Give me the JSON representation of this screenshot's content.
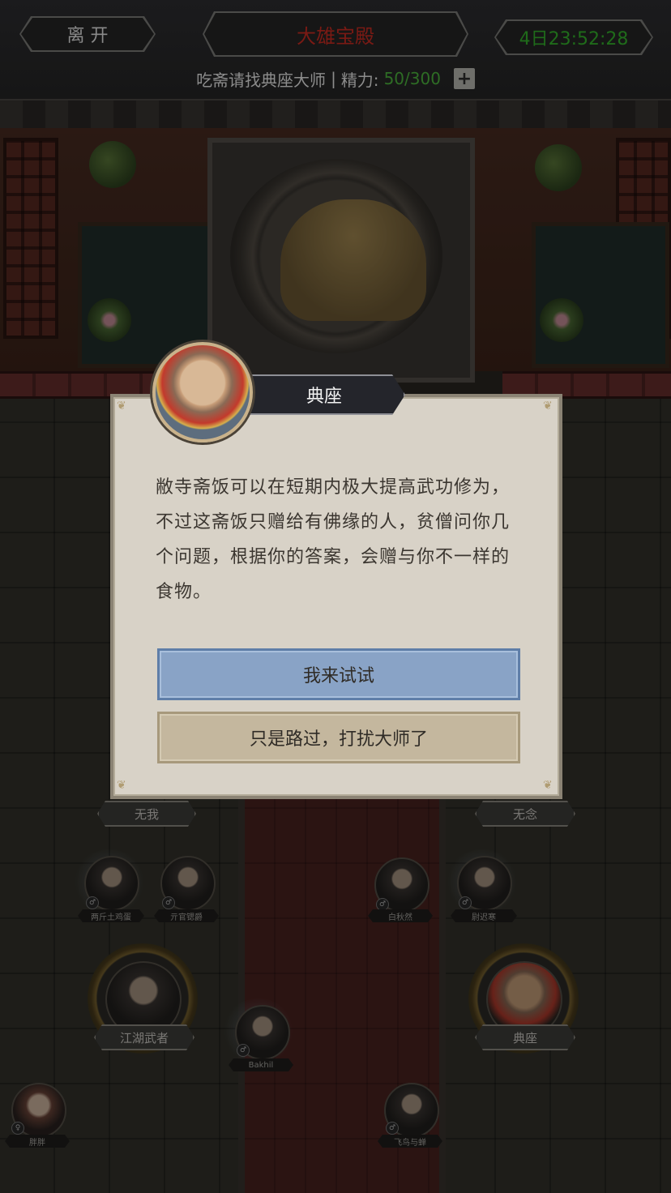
{
  "topbar": {
    "leave_label": "离 开",
    "location_title": "大雄宝殿",
    "time": "4日23:52:28",
    "quest_text": "吃斋请找典座大师",
    "separator": "|",
    "stamina_label": "精力:",
    "stamina_value": "50/300",
    "stamina_plus": "+"
  },
  "dialog": {
    "speaker": "典座",
    "text": "敝寺斋饭可以在短期内极大提高武功修为，不过这斋饭只赠给有佛缘的人，贫僧问你几个问题，根据你的答案，会赠与你不一样的食物。",
    "option_try": "我来试试",
    "option_pass": "只是路过，打扰大师了"
  },
  "npcs": {
    "wuwo": "无我",
    "wunian": "无念",
    "liangjin": "两斤土鸡蛋",
    "yiyan": "亓官锶爵",
    "baiqiu": "白秋然",
    "shechi": "尉迟寒",
    "jianghu": "江湖武者",
    "dianzuo": "典座",
    "bakhil": "Bakhil",
    "pangpang": "胖胖",
    "feiniao": "飞鸟与蝉"
  },
  "colors": {
    "title_red": "#7a1a14",
    "time_green": "#1f6b1a",
    "stamina_green": "#2e6d25",
    "primary_button": "#89a3c6",
    "secondary_button": "#c4b79e"
  }
}
